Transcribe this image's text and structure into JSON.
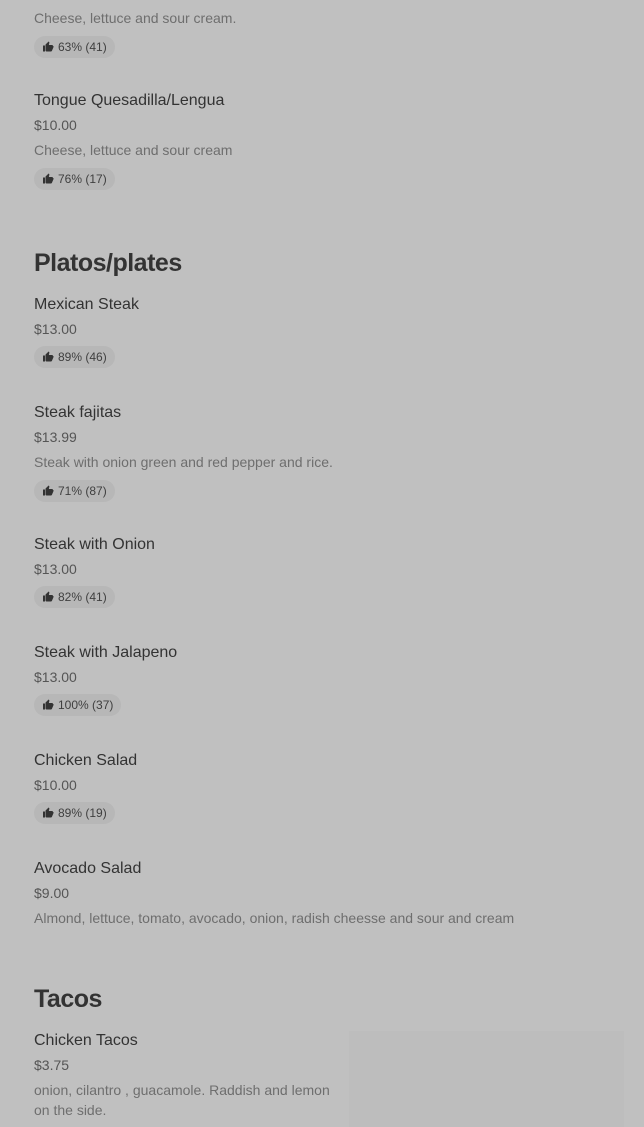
{
  "quesadillas": {
    "partial_item": {
      "description": "Cheese, lettuce and sour cream.",
      "rating": "63% (41)"
    },
    "items": [
      {
        "name": "Tongue Quesadilla/Lengua",
        "price": "$10.00",
        "description": "Cheese, lettuce and sour cream",
        "rating": "76% (17)"
      }
    ]
  },
  "platos": {
    "title": "Platos/plates",
    "items": [
      {
        "name": "Mexican Steak",
        "price": "$13.00",
        "rating": "89% (46)"
      },
      {
        "name": "Steak fajitas",
        "price": "$13.99",
        "description": "Steak with onion green and red pepper and rice.",
        "rating": "71% (87)"
      },
      {
        "name": "Steak with Onion",
        "price": "$13.00",
        "rating": "82% (41)"
      },
      {
        "name": "Steak with Jalapeno",
        "price": "$13.00",
        "rating": "100% (37)"
      },
      {
        "name": "Chicken Salad",
        "price": "$10.00",
        "rating": "89% (19)"
      },
      {
        "name": "Avocado Salad",
        "price": "$9.00",
        "description": "Almond, lettuce, tomato, avocado, onion, radish cheesse and sour and cream"
      }
    ]
  },
  "tacos": {
    "title": "Tacos",
    "items": [
      {
        "name": "Chicken Tacos",
        "price": "$3.75",
        "description": "onion, cilantro , guacamole. Raddish and lemon on the side."
      }
    ]
  },
  "icons": {
    "rating": "thumbs-up-icon"
  }
}
